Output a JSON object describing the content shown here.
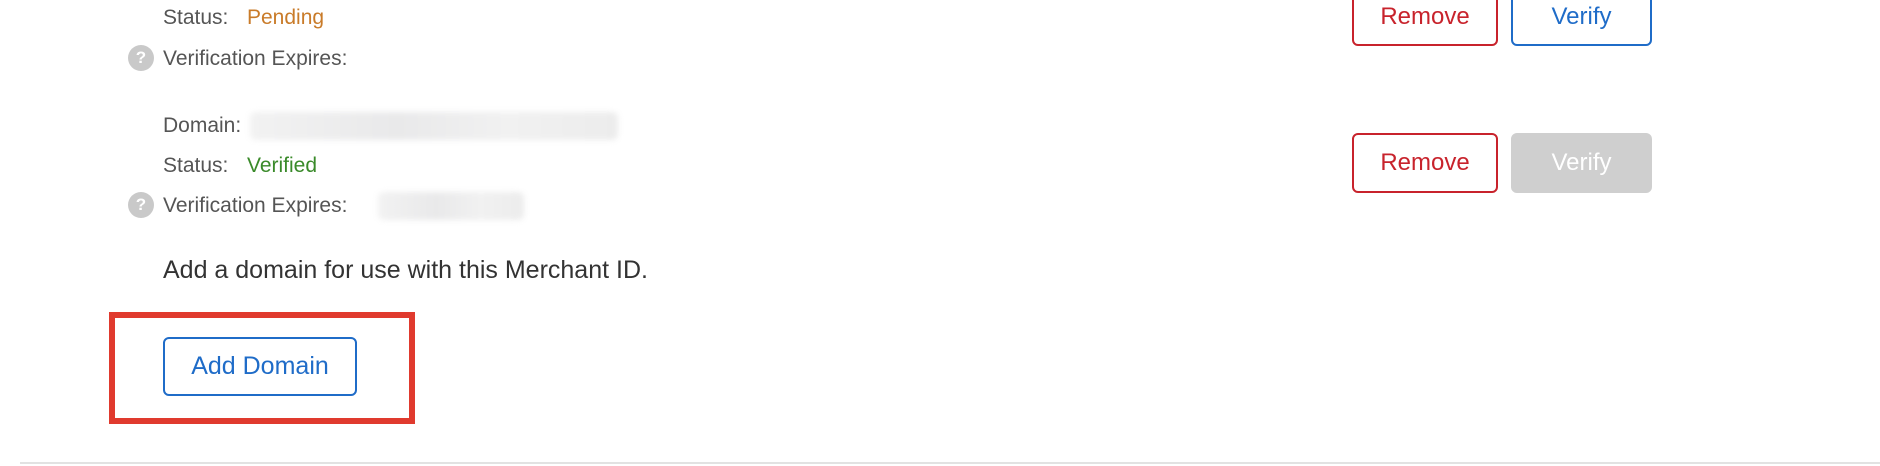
{
  "domains": [
    {
      "status_label": "Status:",
      "status_value": "Pending",
      "expires_label": "Verification Expires:",
      "help_glyph": "?",
      "remove_label": "Remove",
      "verify_label": "Verify",
      "verify_enabled": true
    },
    {
      "domain_label": "Domain:",
      "status_label": "Status:",
      "status_value": "Verified",
      "expires_label": "Verification Expires:",
      "help_glyph": "?",
      "remove_label": "Remove",
      "verify_label": "Verify",
      "verify_enabled": false
    }
  ],
  "add_domain": {
    "description": "Add a domain for use with this Merchant ID.",
    "button_label": "Add Domain"
  },
  "colors": {
    "pending": "#c97b29",
    "verified": "#3a8a2a",
    "remove": "#c8232c",
    "verify": "#1f6cc8",
    "highlight": "#e03a2e"
  }
}
